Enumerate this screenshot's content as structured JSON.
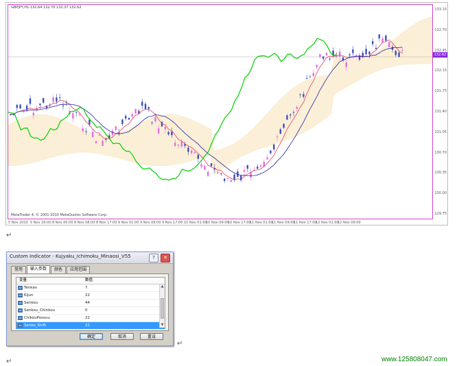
{
  "chart": {
    "symbol_line": "GBPJPY,H1  132.64 132.70 132.37 132.62",
    "copyright": "MetaTrader 4, © 2001-2010 MetaQuotes Software Corp.",
    "current_price": "132.62",
    "price_axis": [
      "133.15",
      "132.70",
      "132.45",
      "132.15",
      "131.75",
      "131.40",
      "131.05",
      "130.70",
      "130.35",
      "130.00",
      "129.75"
    ],
    "time_axis": [
      "5 Nov 2010",
      "5 Nov 16:00",
      "8 Nov 00:00",
      "8 Nov 08:00",
      "8 Nov 17:00",
      "9 Nov 01:00",
      "9 Nov 09:00",
      "9 Nov 17:00",
      "10 Nov 01:00",
      "10 Nov 09:00",
      "10 Nov 17:00",
      "11 Nov 01:00",
      "11 Nov 09:00",
      "11 Nov 17:00",
      "12 Nov 01:00",
      "12 Nov 09:00"
    ],
    "colors": {
      "bull": "#3a4fb8",
      "bear": "#e070e0",
      "chikou": "#00d000",
      "kijun": "#2020a0",
      "tenkan": "#e04060",
      "kumo": "#f0c060",
      "border": "#cc44cc"
    }
  },
  "dialog": {
    "title": "Custom Indicator - Kujyaku_Ichimoku_Minaosi_V55",
    "help_label": "?",
    "close_label": "✕",
    "tabs": [
      "常用",
      "输入参数",
      "颜色",
      "应用范围"
    ],
    "active_tab": 1,
    "table": {
      "headers": [
        "变量",
        "数值"
      ],
      "rows": [
        {
          "name": "Tenkan",
          "value": "7"
        },
        {
          "name": "Kijun",
          "value": "22"
        },
        {
          "name": "Senkou",
          "value": "44"
        },
        {
          "name": "Senkou_Chinkou",
          "value": "0"
        },
        {
          "name": "ChikouPossuu",
          "value": "22"
        },
        {
          "name": "Senko_Shift",
          "value": "21"
        }
      ],
      "selected_row": 5,
      "row_icon": "ab"
    },
    "buttons": {
      "ok": "确定",
      "cancel": "取消",
      "reset": "重设"
    }
  },
  "watermark": "www.125808047.com",
  "paragraph_mark": "↵"
}
